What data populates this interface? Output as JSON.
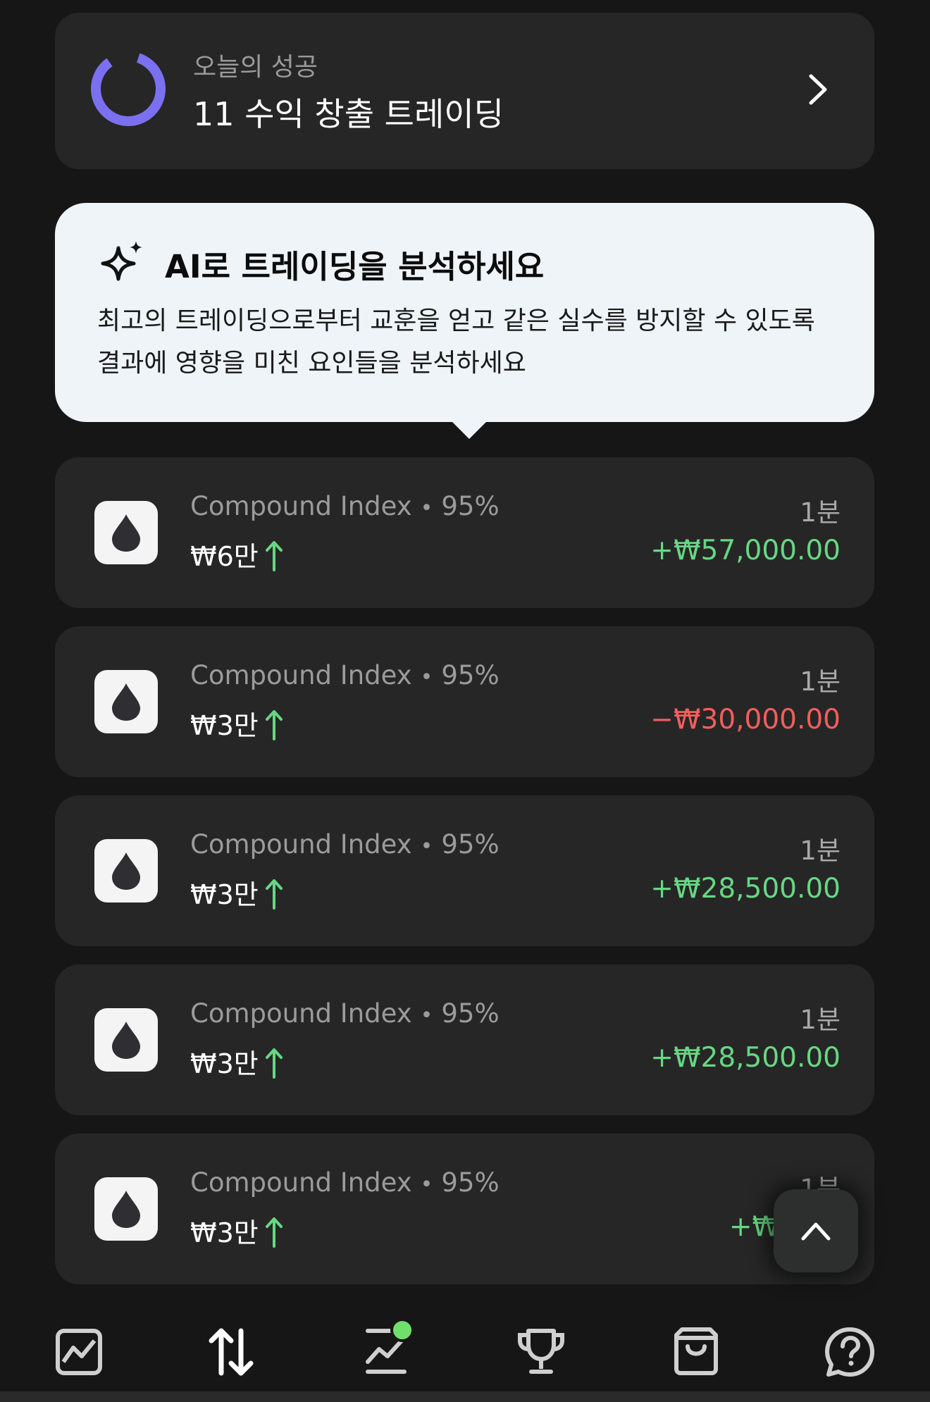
{
  "summary": {
    "subtitle": "오늘의 성공",
    "title": "11 수익 창출 트레이딩",
    "accent_color": "#7b70f0",
    "icons": {
      "progress": "progress-ring-icon",
      "chevron": "chevron-right-icon"
    }
  },
  "ai_tip": {
    "title": "AI로 트레이딩을 분석하세요",
    "body": "최고의 트레이딩으로부터 교훈을 얻고 같은 실수를 방지할 수 있도록 결과에 영향을 미친 요인들을 분석하세요",
    "icon": "sparkle-icon"
  },
  "trades": [
    {
      "asset": "Compound Index",
      "payout": "95%",
      "amount": "₩6만",
      "direction": "up",
      "duration": "1분",
      "result": "+₩57,000.00",
      "result_type": "positive"
    },
    {
      "asset": "Compound Index",
      "payout": "95%",
      "amount": "₩3만",
      "direction": "up",
      "duration": "1분",
      "result": "−₩30,000.00",
      "result_type": "negative"
    },
    {
      "asset": "Compound Index",
      "payout": "95%",
      "amount": "₩3만",
      "direction": "up",
      "duration": "1분",
      "result": "+₩28,500.00",
      "result_type": "positive"
    },
    {
      "asset": "Compound Index",
      "payout": "95%",
      "amount": "₩3만",
      "direction": "up",
      "duration": "1분",
      "result": "+₩28,500.00",
      "result_type": "positive"
    },
    {
      "asset": "Compound Index",
      "payout": "95%",
      "amount": "₩3만",
      "direction": "up",
      "duration": "1분",
      "result": "+₩28,5",
      "result_type": "positive"
    }
  ],
  "colors": {
    "positive": "#67d783",
    "negative": "#f25f5c",
    "card": "#262626",
    "background": "#161616"
  },
  "bottom_nav": [
    {
      "icon": "chart-icon"
    },
    {
      "icon": "trade-arrows-icon"
    },
    {
      "icon": "analytics-icon",
      "badge": true
    },
    {
      "icon": "trophy-icon"
    },
    {
      "icon": "shop-bag-icon"
    },
    {
      "icon": "help-icon"
    }
  ]
}
